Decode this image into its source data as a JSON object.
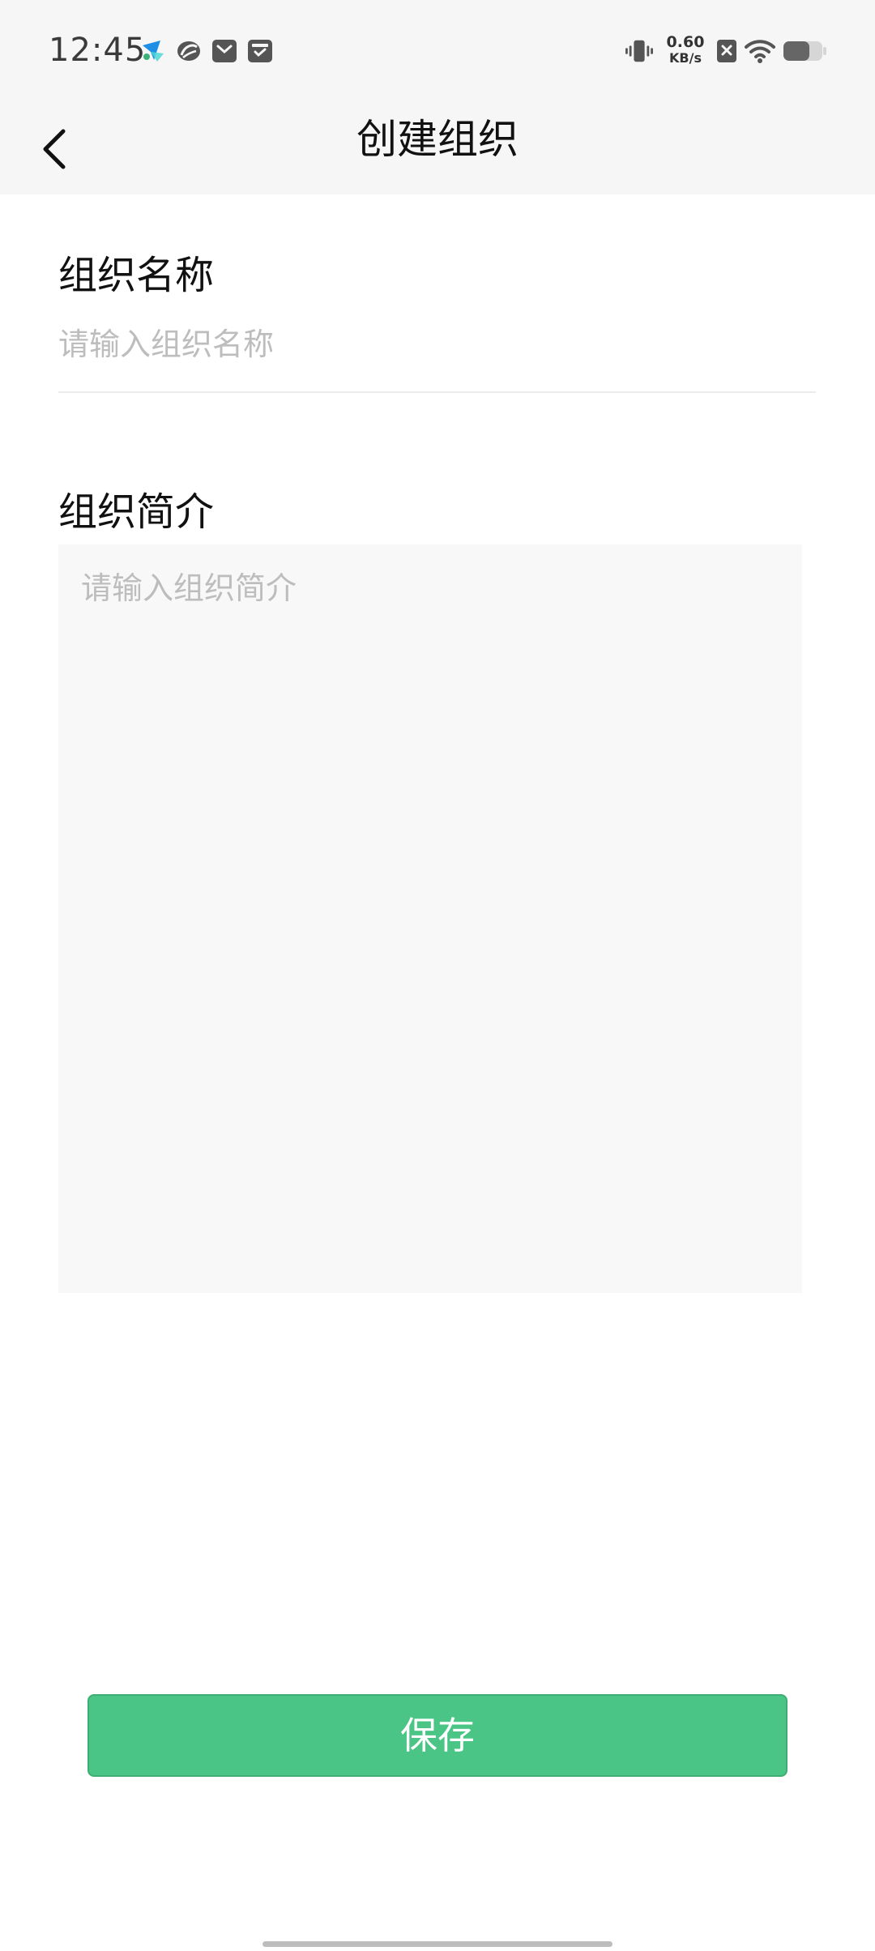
{
  "status_bar": {
    "time": "12:45",
    "notification_icons": [
      "feishu-app-icon",
      "sync-app-icon",
      "mail-app-icon",
      "inbox-app-icon"
    ],
    "net_speed_value": "0.60",
    "net_speed_unit": "KB/s",
    "system_icons": [
      "vibrate-icon",
      "net-speed",
      "sim-no-signal-icon",
      "wifi-icon",
      "battery-icon"
    ]
  },
  "header": {
    "title": "创建组织",
    "back_icon": "chevron-left-icon"
  },
  "form": {
    "name_label": "组织名称",
    "name_placeholder": "请输入组织名称",
    "name_value": "",
    "intro_label": "组织简介",
    "intro_placeholder": "请输入组织简介",
    "intro_value": ""
  },
  "actions": {
    "save_label": "保存"
  },
  "colors": {
    "accent": "#4ac586",
    "header_bg": "#f6f6f6",
    "textarea_bg": "#f8f8f8",
    "placeholder": "#bdbdbd"
  }
}
